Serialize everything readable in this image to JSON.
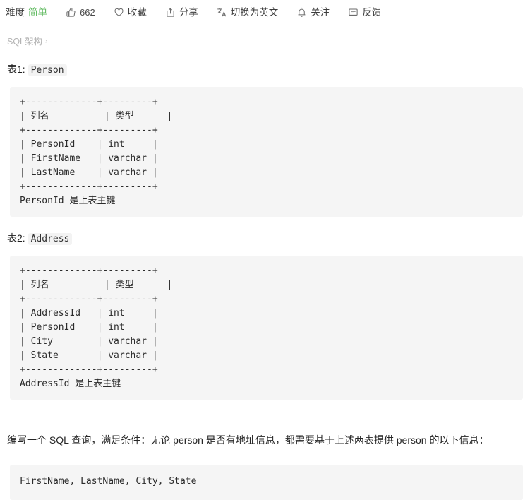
{
  "toolbar": {
    "difficulty_label": "难度",
    "difficulty_value": "简单",
    "like_count": "662",
    "favorite_label": "收藏",
    "share_label": "分享",
    "translate_label": "切换为英文",
    "follow_label": "关注",
    "feedback_label": "反馈",
    "icons": {
      "thumbs_up": "thumbs-up-icon",
      "heart": "heart-icon",
      "share": "share-icon",
      "translate": "translate-icon",
      "bell": "bell-icon",
      "feedback": "feedback-icon"
    },
    "accent_color": "#5cb85c"
  },
  "breadcrumb": {
    "label": "SQL架构",
    "chevron": "›"
  },
  "tables": [
    {
      "caption_prefix": "表1:",
      "caption_name": "Person",
      "code": "+-------------+---------+\n| 列名          | 类型      |\n+-------------+---------+\n| PersonId    | int     |\n| FirstName   | varchar |\n| LastName    | varchar |\n+-------------+---------+\nPersonId 是上表主键"
    },
    {
      "caption_prefix": "表2:",
      "caption_name": "Address",
      "code": "+-------------+---------+\n| 列名          | 类型      |\n+-------------+---------+\n| AddressId   | int     |\n| PersonId    | int     |\n| City        | varchar |\n| State       | varchar |\n+-------------+---------+\nAddressId 是上表主键"
    }
  ],
  "question": {
    "text": "编写一个 SQL 查询，满足条件：无论 person 是否有地址信息，都需要基于上述两表提供 person 的以下信息："
  },
  "answer_fields": {
    "code": "FirstName, LastName, City, State"
  }
}
